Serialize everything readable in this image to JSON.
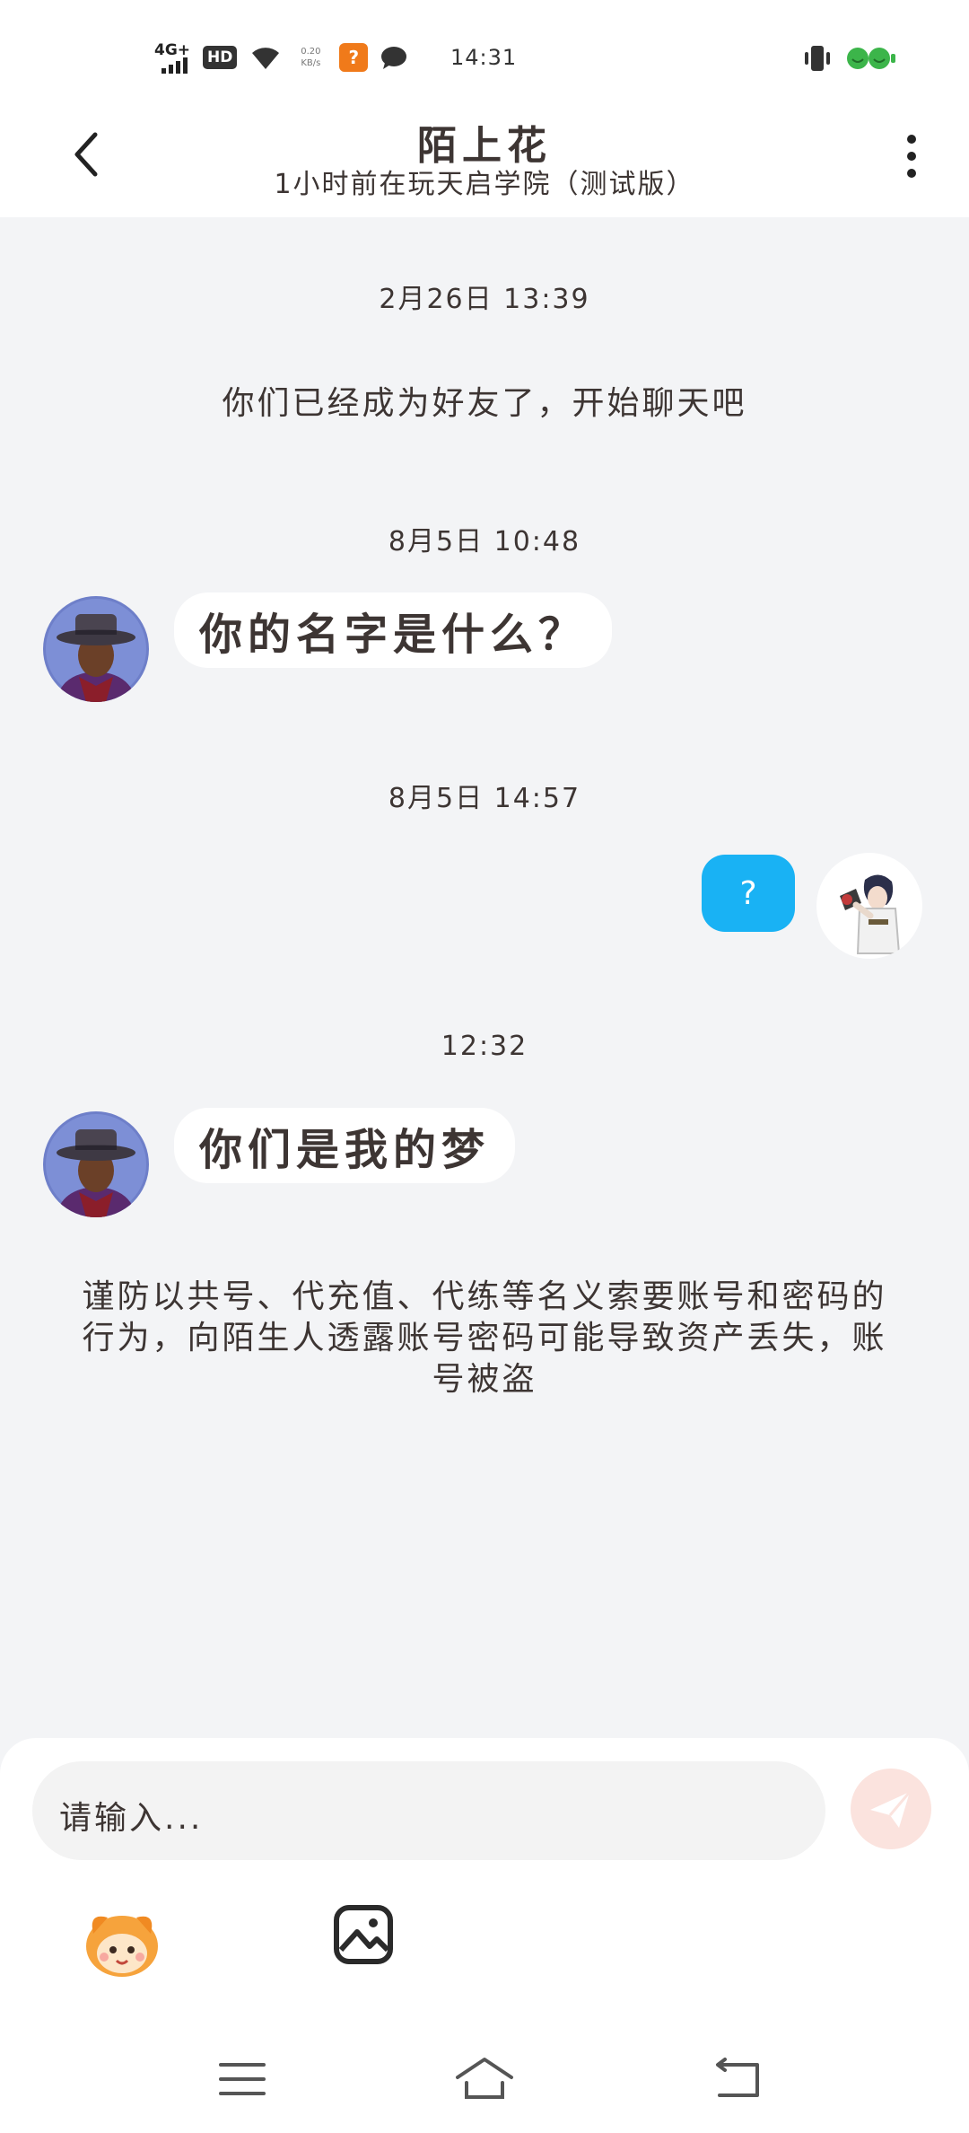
{
  "status_bar": {
    "network": "4G+",
    "hd": "HD",
    "speed_value": "0.20",
    "speed_unit": "KB/s",
    "app_badge": "?",
    "time": "14:31"
  },
  "header": {
    "title": "陌上花",
    "subtitle": "1小时前在玩天启学院（测试版）"
  },
  "chat": {
    "stamp_1": "2月26日 13:39",
    "system_message": "你们已经成为好友了，开始聊天吧",
    "stamp_2": "8月5日 10:48",
    "msg_1": "你的名字是什么？",
    "stamp_3": "8月5日 14:57",
    "msg_2_out": "?",
    "stamp_4": "12:32",
    "msg_3": "你们是我的梦",
    "warning": "谨防以共号、代充值、代练等名义索要账号和密码的行为，向陌生人透露账号密码可能导致资产丢失，账号被盗"
  },
  "composer": {
    "placeholder": "请输入..."
  },
  "colors": {
    "accent_blue": "#19b2f4",
    "send_disabled": "#fbe3de",
    "background": "#f3f4f6"
  },
  "icons": [
    "back-arrow-icon",
    "more-vertical-icon",
    "send-icon",
    "emoji-icon",
    "image-icon",
    "menu-icon",
    "home-icon",
    "return-icon"
  ]
}
